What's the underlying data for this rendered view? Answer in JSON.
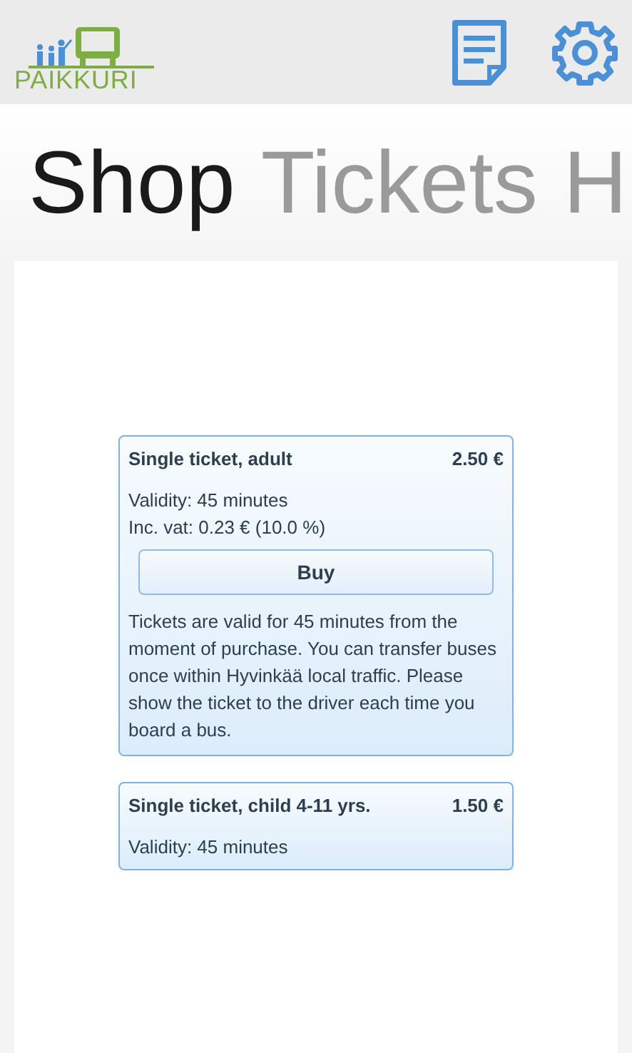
{
  "header": {
    "logo_text": "PAIKKURI"
  },
  "pivot": [
    {
      "label": "Shop",
      "selected": true
    },
    {
      "label": "Tickets",
      "selected": false
    },
    {
      "label": "H",
      "selected": false
    }
  ],
  "tickets": [
    {
      "title": "Single ticket, adult",
      "price": "2.50 €",
      "details": [
        "Validity: 45 minutes",
        "Inc. vat: 0.23 € (10.0 %)"
      ],
      "button": "Buy",
      "description": "Tickets are valid for 45 minutes from the moment of purchase. You can transfer buses once within Hyvinkää local traffic. Please show the ticket to the driver each time you board a bus."
    },
    {
      "title": "Single ticket, child 4-11 yrs.",
      "price": "1.50 €",
      "details": [
        "Validity: 45 minutes"
      ]
    }
  ]
}
